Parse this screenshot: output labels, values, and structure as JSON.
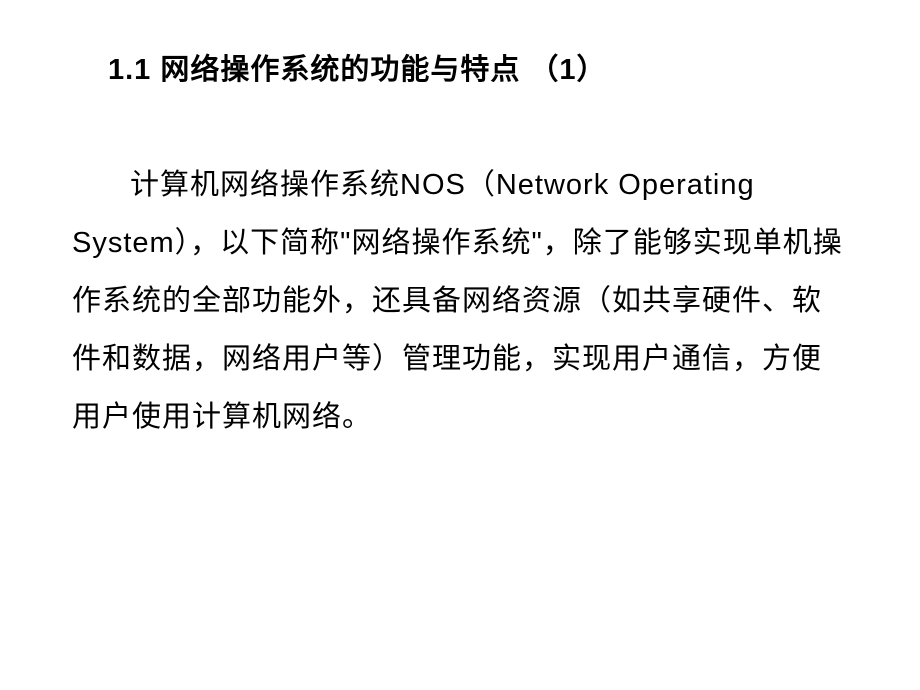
{
  "slide": {
    "heading": "1.1 网络操作系统的功能与特点 （1）",
    "body": "计算机网络操作系统NOS（Network Operating System），以下简称\"网络操作系统\"，除了能够实现单机操作系统的全部功能外，还具备网络资源（如共享硬件、软件和数据，网络用户等）管理功能，实现用户通信，方便用户使用计算机网络。"
  }
}
